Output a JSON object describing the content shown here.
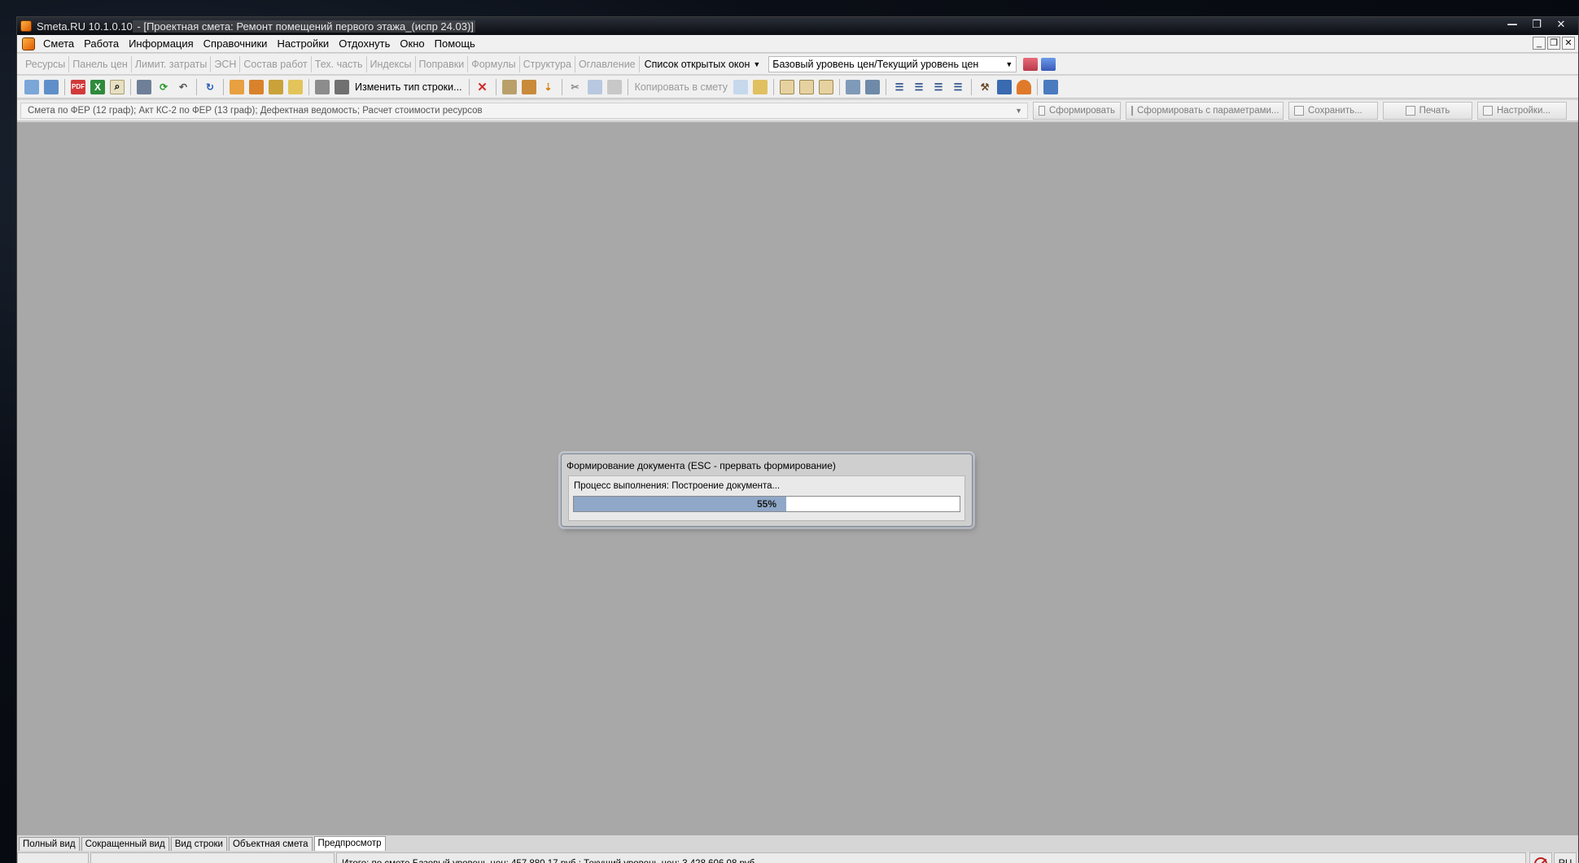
{
  "window": {
    "app_title": "Smeta.RU  10.1.0.10",
    "doc_title": " - [Проектная смета: Ремонт помещений первого этажа_(испр 24.03)]",
    "controls": [
      "—",
      "❐",
      "✕"
    ]
  },
  "menu": {
    "items": [
      "Смета",
      "Работа",
      "Информация",
      "Справочники",
      "Настройки",
      "Отдохнуть",
      "Окно",
      "Помощь"
    ],
    "mdi_controls": [
      "_",
      "❐",
      "✕"
    ]
  },
  "toolbar1": {
    "tabs": [
      "Ресурсы",
      "Панель цен",
      "Лимит. затраты",
      "ЭСН",
      "Состав работ",
      "Тех. часть",
      "Индексы",
      "Поправки",
      "Формулы",
      "Структура",
      "Оглавление"
    ],
    "open_windows": "Список открытых окон",
    "price_level": "Базовый уровень цен/Текущий уровень цен"
  },
  "toolbar2": {
    "change_row_type": "Изменить тип строки...",
    "copy_to_estimate": "Копировать в смету"
  },
  "reportbar": {
    "report_list": "Смета по ФЕР (12 граф); Акт КС-2 по ФЕР (13 граф); Дефектная ведомость; Расчет стоимости ресурсов",
    "generate": "Сформировать",
    "generate_params": "Сформировать с параметрами...",
    "save": "Сохранить...",
    "print": "Печать",
    "settings": "Настройки..."
  },
  "dialog": {
    "title": "Формирование документа (ESC - прервать формирование)",
    "message": "Процесс выполнения: Построение документа...",
    "progress_percent": 55,
    "progress_label": "55%"
  },
  "tabs": [
    "Полный вид",
    "Сокращенный вид",
    "Вид строки",
    "Объектная смета",
    "Предпросмотр"
  ],
  "active_tab": "Предпросмотр",
  "status": {
    "total": "Итого: по смете Базовый уровень цен: 457 880,17 руб.;  Текущий уровень цен: 3 428 606,08 руб.",
    "lang": "RU"
  },
  "colors": {
    "workspace": "#a8a8a8",
    "progress_fill": "#8fa8c8",
    "titlebar": "#0b0d12"
  }
}
